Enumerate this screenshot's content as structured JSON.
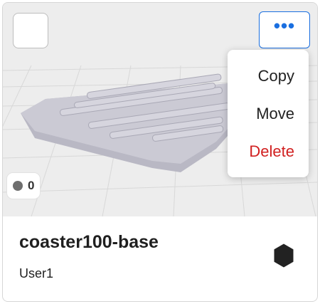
{
  "card": {
    "title": "coaster100-base",
    "owner": "User1",
    "status_label": "0"
  },
  "menu": {
    "items": [
      "Copy",
      "Move",
      "Delete"
    ]
  },
  "icons": {
    "more": "ellipsis-icon",
    "part": "hexagon-icon"
  },
  "colors": {
    "accent": "#1a6fe0",
    "danger": "#d12020",
    "status_dot": "#6e6e6e"
  }
}
